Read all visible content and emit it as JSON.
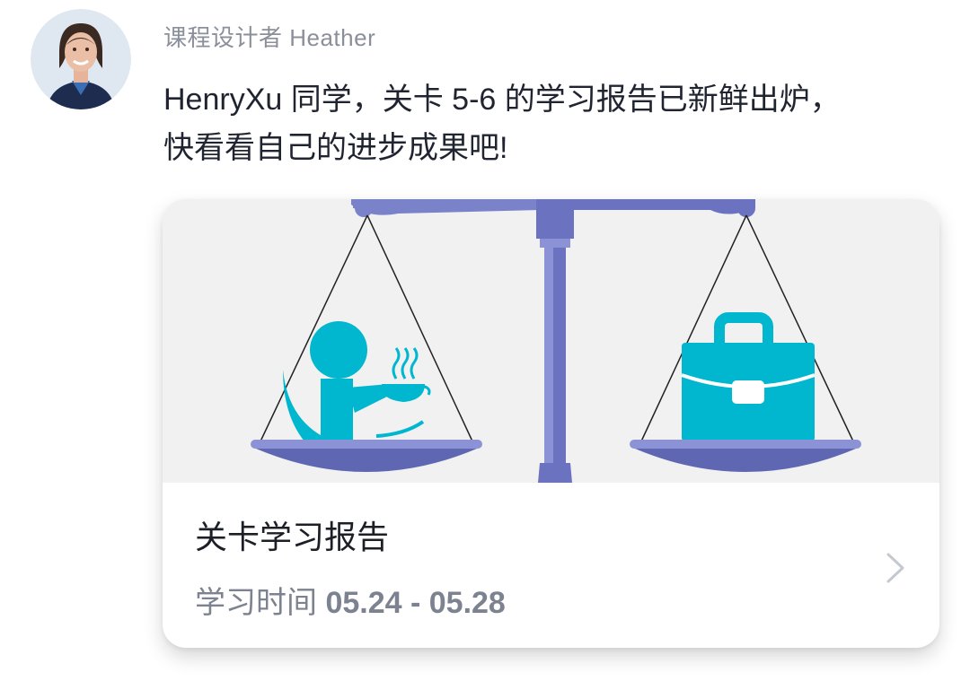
{
  "sender": {
    "name": "课程设计者 Heather",
    "avatar_icon": "teacher-avatar"
  },
  "message": {
    "line1": "HenryXu 同学，关卡 5-6 的学习报告已新鲜出炉，",
    "line2": "快看看自己的进步成果吧!"
  },
  "card": {
    "image_icon": "work-life-balance-scale-illustration",
    "title": "关卡学习报告",
    "subtitle_label": "学习时间 ",
    "date_range": "05.24 - 05.28",
    "chevron_icon": "chevron-right-icon"
  },
  "colors": {
    "scale": "#6b73c1",
    "scale_light": "#8b93d6",
    "accent_teal": "#00b7cf",
    "image_bg": "#f1f1f1",
    "text_primary": "#1f2430",
    "text_secondary": "#7c8290"
  }
}
